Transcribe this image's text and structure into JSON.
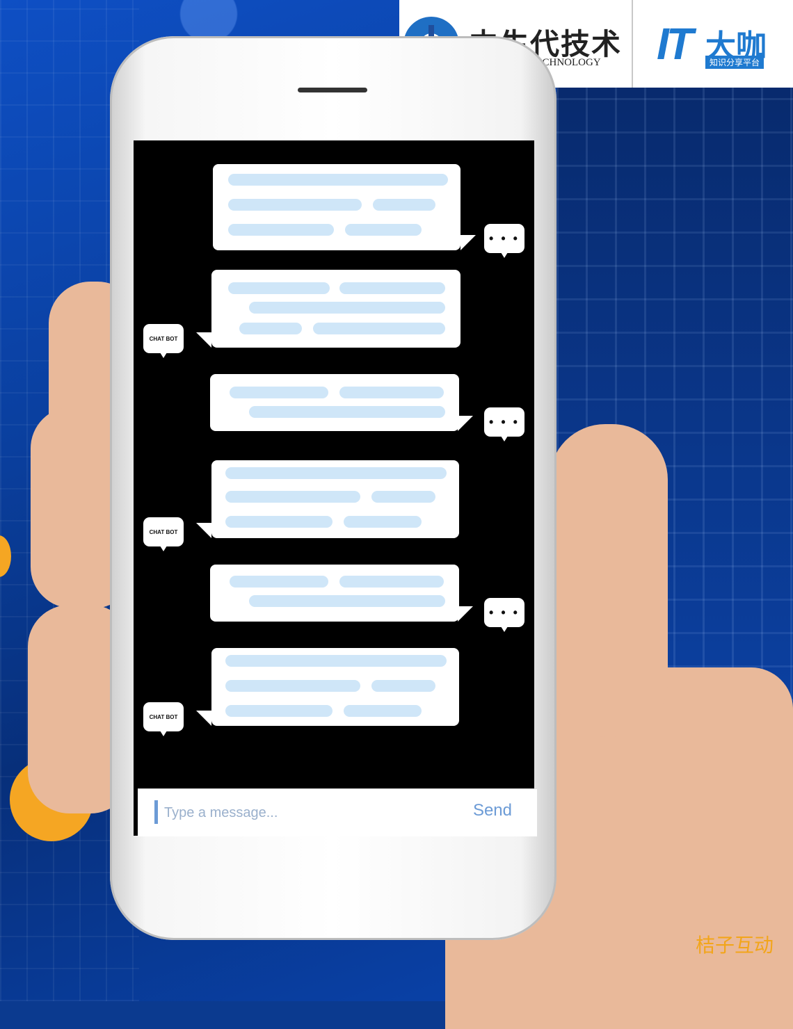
{
  "brand": {
    "cn_name": "中生代技术",
    "en_name": "FRESHMAN TECHNOLOGY",
    "partner_it": "IT",
    "partner_cn": "大咖",
    "partner_sub": "知识分享平台"
  },
  "chat": {
    "messages": [
      {
        "side": "user",
        "avatar": "• • •"
      },
      {
        "side": "bot",
        "avatar": "CHAT BOT"
      },
      {
        "side": "user",
        "avatar": "• • •"
      },
      {
        "side": "bot",
        "avatar": "CHAT BOT"
      },
      {
        "side": "user",
        "avatar": "• • •"
      },
      {
        "side": "bot",
        "avatar": "CHAT BOT"
      }
    ]
  },
  "composer": {
    "placeholder": "Type a message...",
    "send_label": "Send"
  },
  "watermark": "桔子互动",
  "colors": {
    "bubble_line": "#cfe6f8",
    "accent": "#6c9bd6",
    "brand_blue": "#1f7ad0",
    "watermark": "#f2a51a"
  }
}
